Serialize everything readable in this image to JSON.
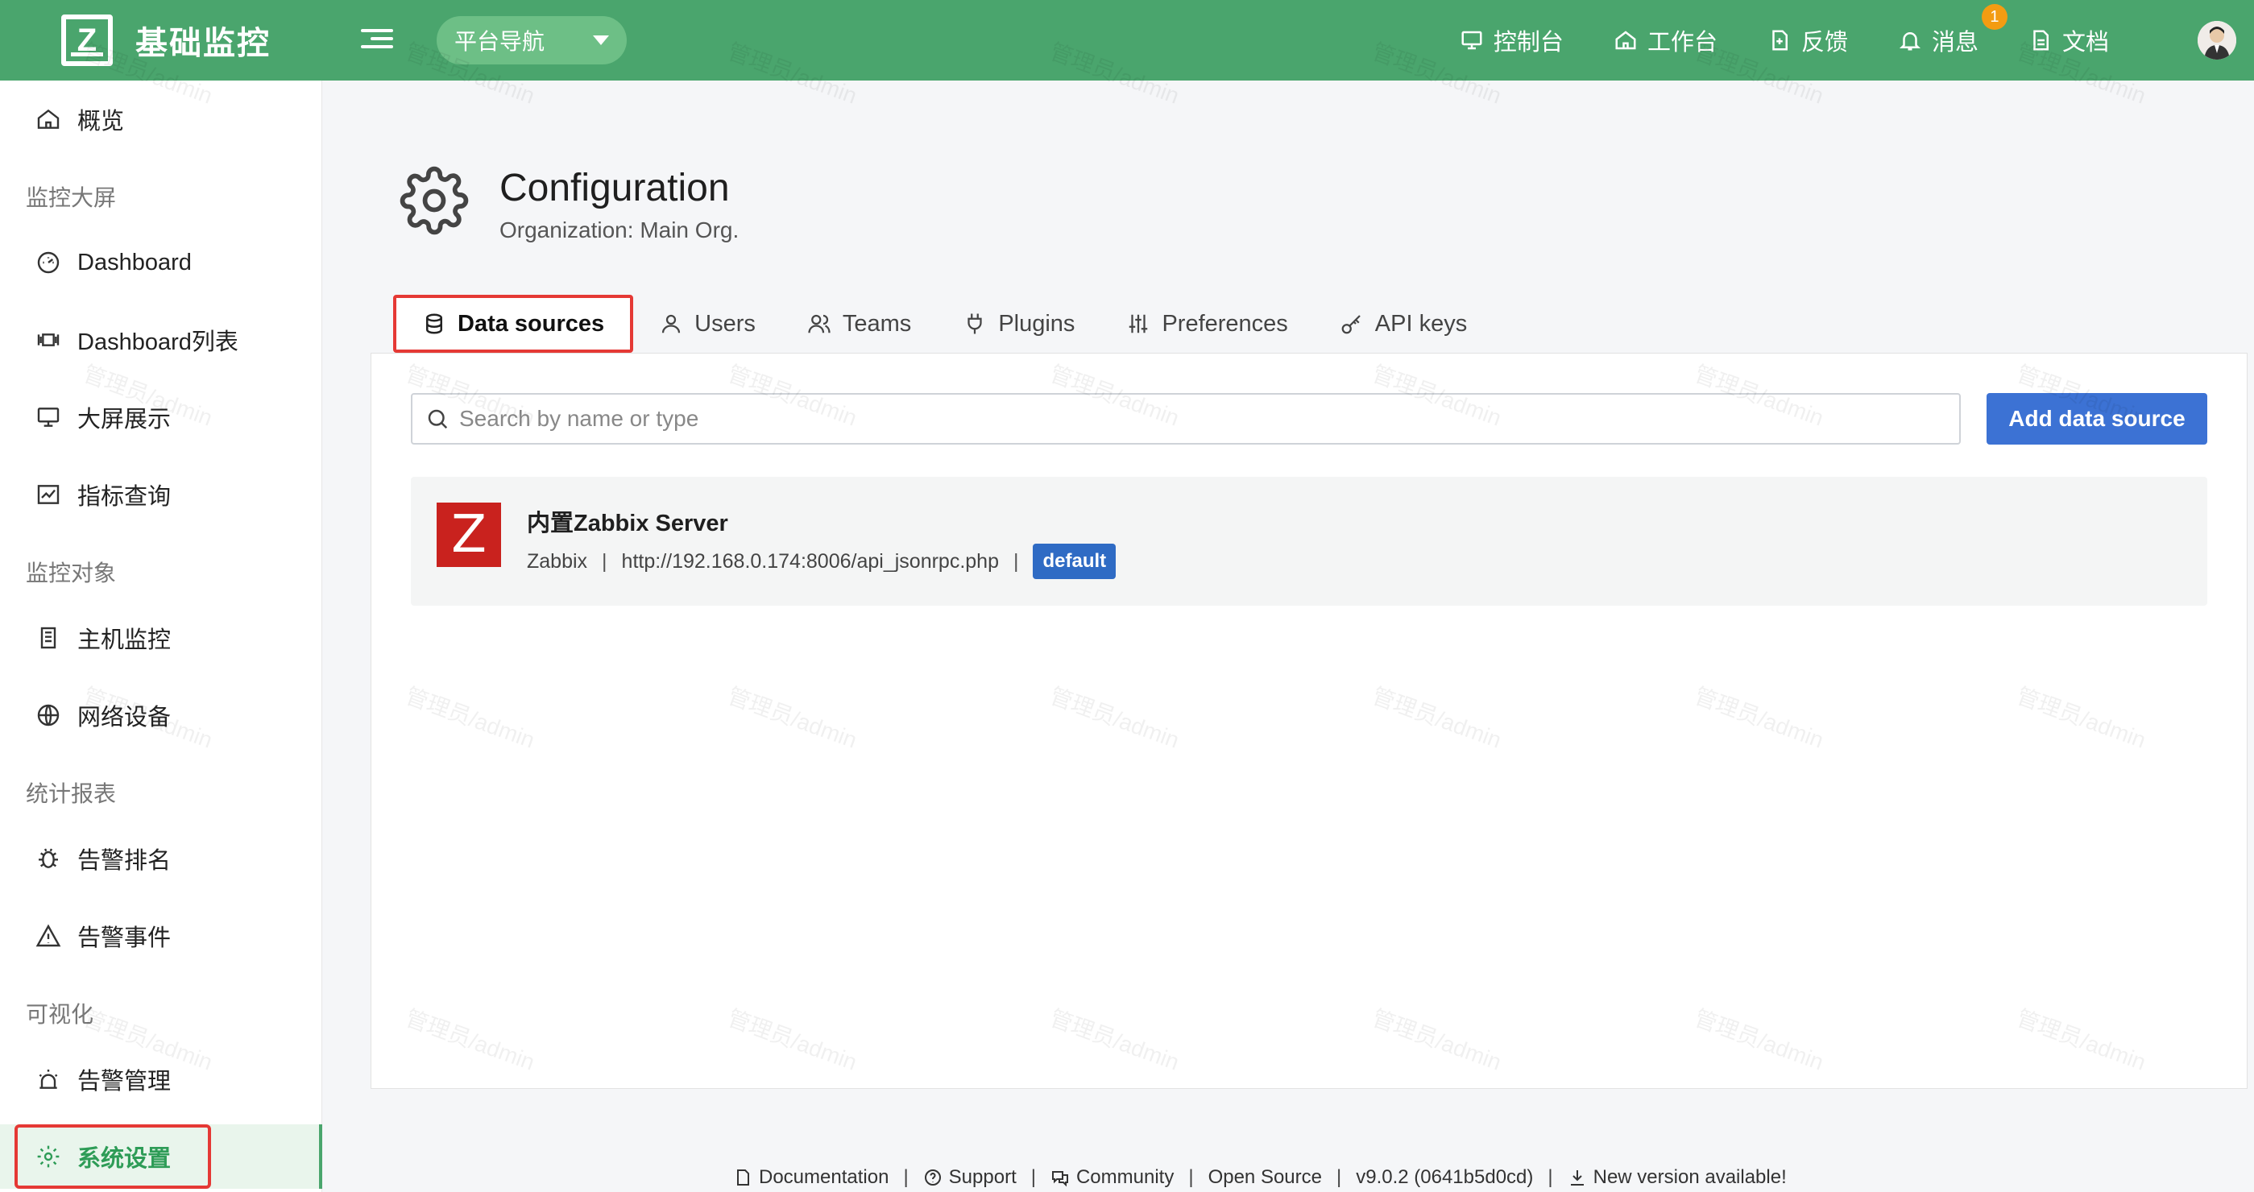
{
  "app": {
    "logo_letter": "Z",
    "title": "基础监控"
  },
  "header": {
    "nav_select": "平台导航",
    "links": [
      {
        "label": "控制台",
        "icon": "monitor-icon"
      },
      {
        "label": "工作台",
        "icon": "home-icon"
      },
      {
        "label": "反馈",
        "icon": "feedback-icon"
      },
      {
        "label": "消息",
        "icon": "bell-icon",
        "badge": "1"
      },
      {
        "label": "文档",
        "icon": "doc-icon"
      }
    ]
  },
  "sidebar": {
    "overview": "概览",
    "group1": "监控大屏",
    "dashboard": "Dashboard",
    "dashboard_list": "Dashboard列表",
    "big_screen": "大屏展示",
    "metric_query": "指标查询",
    "group2": "监控对象",
    "host_monitor": "主机监控",
    "network_device": "网络设备",
    "group3": "统计报表",
    "alert_rank": "告警排名",
    "alert_event": "告警事件",
    "group4": "可视化",
    "alert_manage": "告警管理",
    "system_settings": "系统设置"
  },
  "page": {
    "title": "Configuration",
    "subtitle": "Organization: Main Org."
  },
  "tabs": {
    "data_sources": "Data sources",
    "users": "Users",
    "teams": "Teams",
    "plugins": "Plugins",
    "preferences": "Preferences",
    "api_keys": "API keys"
  },
  "search": {
    "placeholder": "Search by name or type"
  },
  "add_button": "Add data source",
  "datasource": {
    "logo_letter": "Z",
    "name": "内置Zabbix Server",
    "type": "Zabbix",
    "url": "http://192.168.0.174:8006/api_jsonrpc.php",
    "badge": "default"
  },
  "footer": {
    "documentation": "Documentation",
    "support": "Support",
    "community": "Community",
    "open_source": "Open Source",
    "version": "v9.0.2 (0641b5d0cd)",
    "new_version": "New version available!"
  },
  "watermark": "管理员/admin",
  "colors": {
    "topbar": "#4aa56d",
    "accent_blue": "#3c72d4",
    "highlight_red": "#e53935",
    "zabbix_red": "#c9221e"
  }
}
